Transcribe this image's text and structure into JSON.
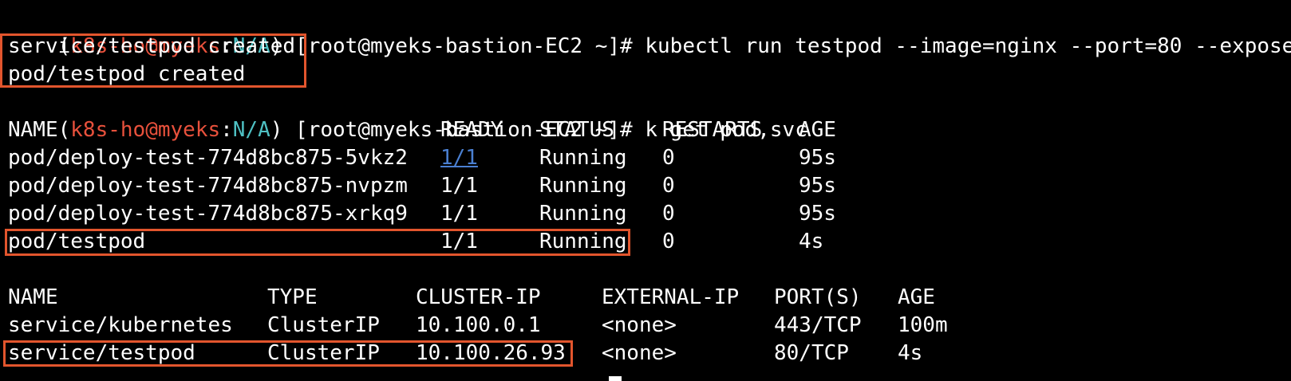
{
  "colors": {
    "background": "#000000",
    "text": "#ffffff",
    "prompt_user": "#e8513c",
    "prompt_context": "#4fc1c4",
    "highlight_box": "#e2552d",
    "link": "#4a7fd1"
  },
  "prompt": {
    "open_paren": "(",
    "user": "k8s-ho@myeks",
    "colon": ":",
    "context": "N/A",
    "host_part": ") [root@myeks-bastion-EC2 ~]#"
  },
  "commands": {
    "first": " kubectl run testpod --image=nginx --port=80 --expose",
    "second": " k get pod,svc"
  },
  "run_output": [
    "service/testpod created",
    "pod/testpod created"
  ],
  "pods_table": {
    "headers": {
      "name": "NAME",
      "ready": "READY",
      "status": "STATUS",
      "restarts": "RESTARTS",
      "age": "AGE"
    },
    "rows": [
      {
        "name": "pod/deploy-test-774d8bc875-5vkz2",
        "ready": "1/1",
        "status": "Running",
        "restarts": "0",
        "age": "95s"
      },
      {
        "name": "pod/deploy-test-774d8bc875-nvpzm",
        "ready": "1/1",
        "status": "Running",
        "restarts": "0",
        "age": "95s"
      },
      {
        "name": "pod/deploy-test-774d8bc875-xrkq9",
        "ready": "1/1",
        "status": "Running",
        "restarts": "0",
        "age": "95s"
      },
      {
        "name": "pod/testpod",
        "ready": "1/1",
        "status": "Running",
        "restarts": "0",
        "age": "4s"
      }
    ]
  },
  "svc_table": {
    "headers": {
      "name": "NAME",
      "type": "TYPE",
      "cluster_ip": "CLUSTER-IP",
      "external_ip": "EXTERNAL-IP",
      "ports": "PORT(S)",
      "age": "AGE"
    },
    "rows": [
      {
        "name": "service/kubernetes",
        "type": "ClusterIP",
        "cluster_ip": "10.100.0.1",
        "external_ip": "<none>",
        "ports": "443/TCP",
        "age": "100m"
      },
      {
        "name": "service/testpod",
        "type": "ClusterIP",
        "cluster_ip": "10.100.26.93",
        "external_ip": "<none>",
        "ports": "80/TCP",
        "age": "4s"
      }
    ]
  }
}
